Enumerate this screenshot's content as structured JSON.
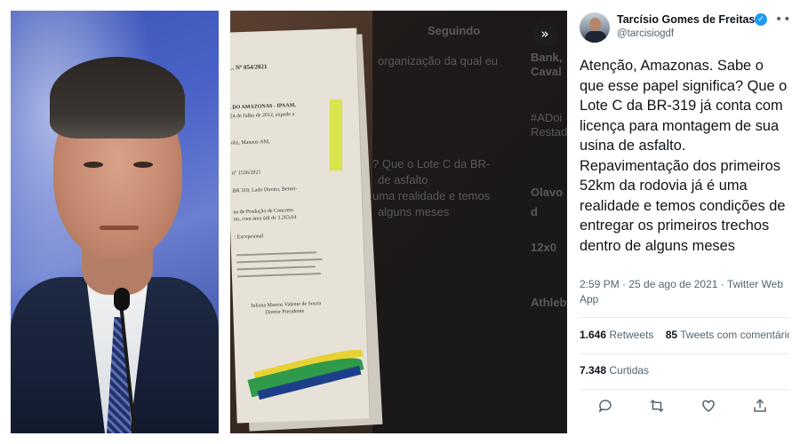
{
  "tweet": {
    "author_name": "Tarcísio Gomes de Freitas",
    "author_handle": "@tarcisiogdf",
    "verified_icon": "verified-badge-icon",
    "more_icon": "more-horizontal-icon",
    "text": "Atenção, Amazonas. Sabe o que esse papel significa? Que o Lote C da BR-319 já conta com licença para montagem de sua usina de asfalto. Repavimentação dos primeiros 52km da rodovia já é uma realidade e temos condições de entregar os primeiros trechos dentro de alguns meses",
    "timestamp": "2:59 PM · 25 de ago de 2021 · Twitter Web App",
    "retweets_count": "1.646",
    "retweets_label": "Retweets",
    "quote_count": "85",
    "quote_label": "Tweets com comentário",
    "likes_count": "7.348",
    "likes_label": "Curtidas",
    "actions": [
      "reply-icon",
      "retweet-icon",
      "like-icon",
      "share-icon"
    ],
    "accent_color": "#1d9bf0"
  },
  "media": {
    "next_icon": "chevrons-right-icon",
    "document": {
      "header": "L. Nº 054/2021",
      "org": ", DO AMAZONAS - IPAAM,",
      "date": "24 de Julho de 2012, expede a",
      "city": "olis, Manaus-AM,",
      "process": "n° 1536/2021",
      "road": "BR 319, Lado Direito, Beruri-",
      "activity": "na de Produção de Concreto",
      "area": "rto, com área útil de 3.263,64",
      "type": ": Excepcional",
      "signature_name": "Juliana Marcos Valente de Souza",
      "signature_title": "Diretor Presidente"
    },
    "background_screen": {
      "header": "Seguindo",
      "line1": "organização da qual eu",
      "line2": "? Que o Lote C da BR-",
      "line3": "de asfalto",
      "line4": "uma realidade e temos",
      "line5": "alguns meses",
      "side1": "Bank,",
      "side2": "Caval",
      "side3": "#ADoi",
      "side4": "Restad",
      "side5": "Olavo d",
      "side6": "12x0",
      "side7": "Athleb"
    }
  }
}
